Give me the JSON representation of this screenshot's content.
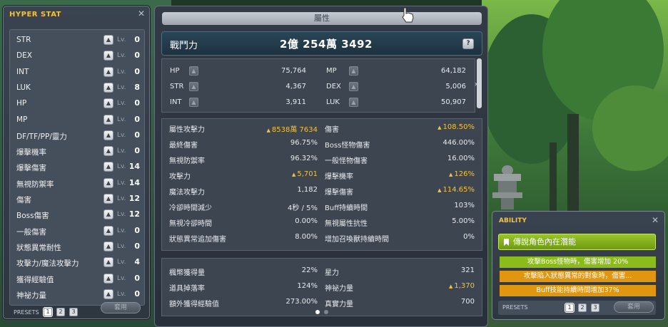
{
  "hyper_stat": {
    "title": "HYPER STAT",
    "lv_label": "Lv.",
    "rows": [
      {
        "label": "STR",
        "level": "0"
      },
      {
        "label": "DEX",
        "level": "0"
      },
      {
        "label": "INT",
        "level": "0"
      },
      {
        "label": "LUK",
        "level": "8"
      },
      {
        "label": "HP",
        "level": "0"
      },
      {
        "label": "MP",
        "level": "0"
      },
      {
        "label": "DF/TF/PP/靈力",
        "level": "0"
      },
      {
        "label": "爆擊機率",
        "level": "0"
      },
      {
        "label": "爆擊傷害",
        "level": "14"
      },
      {
        "label": "無視防禦率",
        "level": "14"
      },
      {
        "label": "傷害",
        "level": "12"
      },
      {
        "label": "Boss傷害",
        "level": "12"
      },
      {
        "label": "一般傷害",
        "level": "0"
      },
      {
        "label": "狀態異常耐性",
        "level": "0"
      },
      {
        "label": "攻擊力/魔法攻擊力",
        "level": "4"
      },
      {
        "label": "獲得經驗值",
        "level": "0"
      },
      {
        "label": "神祕力量",
        "level": "0"
      }
    ],
    "presets_label": "PRESETS",
    "presets": [
      "1",
      "2",
      "3"
    ],
    "apply_label": "套用"
  },
  "stat_window": {
    "tab_title": "屬性",
    "combat_power_label": "戰鬥力",
    "combat_power_value": "2億 254萬 3492",
    "help_label": "?",
    "basic": {
      "hp_label": "HP",
      "hp": "75,764",
      "mp_label": "MP",
      "mp": "64,182",
      "str_label": "STR",
      "str": "4,367",
      "dex_label": "DEX",
      "dex": "5,006",
      "int_label": "INT",
      "int": "3,911",
      "luk_label": "LUK",
      "luk": "50,907"
    },
    "detail_left": [
      {
        "label": "屬性攻擊力",
        "value": "8538萬 7634",
        "up": true
      },
      {
        "label": "最終傷害",
        "value": "96.75%",
        "up": false
      },
      {
        "label": "無視防禦率",
        "value": "96.32%",
        "up": false
      },
      {
        "label": "攻擊力",
        "value": "5,701",
        "up": true
      },
      {
        "label": "魔法攻擊力",
        "value": "1,182",
        "up": false
      },
      {
        "label": "冷卻時間減少",
        "value": "4秒 / 5%",
        "up": false
      },
      {
        "label": "無視冷卻時間",
        "value": "0.00%",
        "up": false
      },
      {
        "label": "狀態異常追加傷害",
        "value": "8.00%",
        "up": false
      }
    ],
    "detail_right": [
      {
        "label": "傷害",
        "value": "108.50%",
        "up": true
      },
      {
        "label": "Boss怪物傷害",
        "value": "446.00%",
        "up": false
      },
      {
        "label": "一般怪物傷害",
        "value": "16.00%",
        "up": false
      },
      {
        "label": "爆擊機率",
        "value": "126%",
        "up": true
      },
      {
        "label": "爆擊傷害",
        "value": "114.65%",
        "up": true
      },
      {
        "label": "Buff持續時間",
        "value": "103%",
        "up": false
      },
      {
        "label": "無視屬性抗性",
        "value": "5.00%",
        "up": false
      },
      {
        "label": "增加召喚獸持續時間",
        "value": "0%",
        "up": false
      }
    ],
    "misc_left": [
      {
        "label": "楓幣獲得量",
        "value": "22%"
      },
      {
        "label": "道具掉落率",
        "value": "124%"
      },
      {
        "label": "額外獲得經驗值",
        "value": "273.00%"
      }
    ],
    "misc_right": [
      {
        "label": "星力",
        "value": "321",
        "up": false
      },
      {
        "label": "神祕力量",
        "value": "1,370",
        "up": true
      },
      {
        "label": "真實力量",
        "value": "700",
        "up": false
      }
    ]
  },
  "ability": {
    "title": "ABILITY",
    "grade": "傳說角色內在潛能",
    "lines": [
      {
        "text": "攻擊Boss怪物時，傷害增加 20%",
        "color": "#8cbc1c"
      },
      {
        "text": "攻擊陷入狀態異常的對象時，傷害...",
        "color": "#e0960e"
      },
      {
        "text": "Buff技能持續時間增加37%",
        "color": "#e0960e"
      }
    ],
    "presets_label": "PRESETS",
    "presets": [
      "1",
      "2",
      "3"
    ],
    "apply_label": "套用"
  },
  "colors": {
    "accent_gold": "#f5c23b",
    "legend_green": "#8cbc1c",
    "unique_orange": "#e0960e"
  }
}
